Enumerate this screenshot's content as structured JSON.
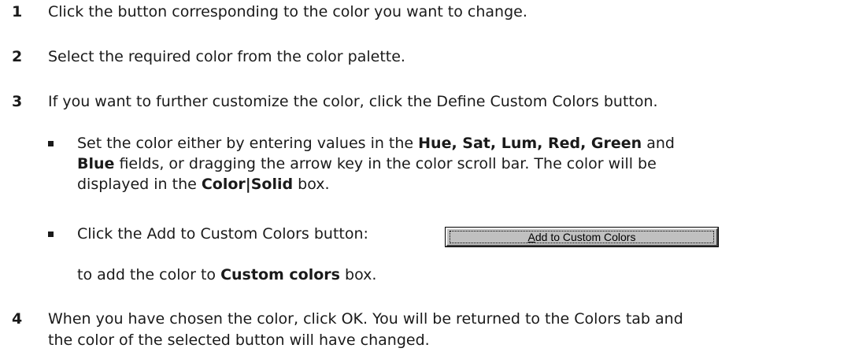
{
  "steps": [
    {
      "number": "1",
      "text": "Click the button corresponding to the color you want to change."
    },
    {
      "number": "2",
      "text": "Select the required color from the color palette."
    },
    {
      "number": "3",
      "text": "If you want to further customize the color, click the Define Custom Colors button."
    },
    {
      "number": "4",
      "text_line1": "When you have chosen the color, click OK. You will be returned to the Colors tab and",
      "text_line2": "the color of the selected button will have changed."
    }
  ],
  "bullets": {
    "b1": {
      "l1_pre": "Set the color either by entering values in the ",
      "l1_bold": "Hue, Sat, Lum, Red, Green",
      "l1_mid": " and",
      "l2_bold": "Blue",
      "l2_post": " fields, or dragging the arrow key in the color scroll bar. The color will be",
      "l3_pre": "displayed in the ",
      "l3_bold": "Color|Solid",
      "l3_post": " box."
    },
    "b2": {
      "text": "Click the Add to Custom Colors button:",
      "cont_pre": "to add the color to ",
      "cont_bold": "Custom colors",
      "cont_post": " box."
    }
  },
  "button": {
    "accel": "A",
    "rest": "dd to Custom Colors"
  }
}
